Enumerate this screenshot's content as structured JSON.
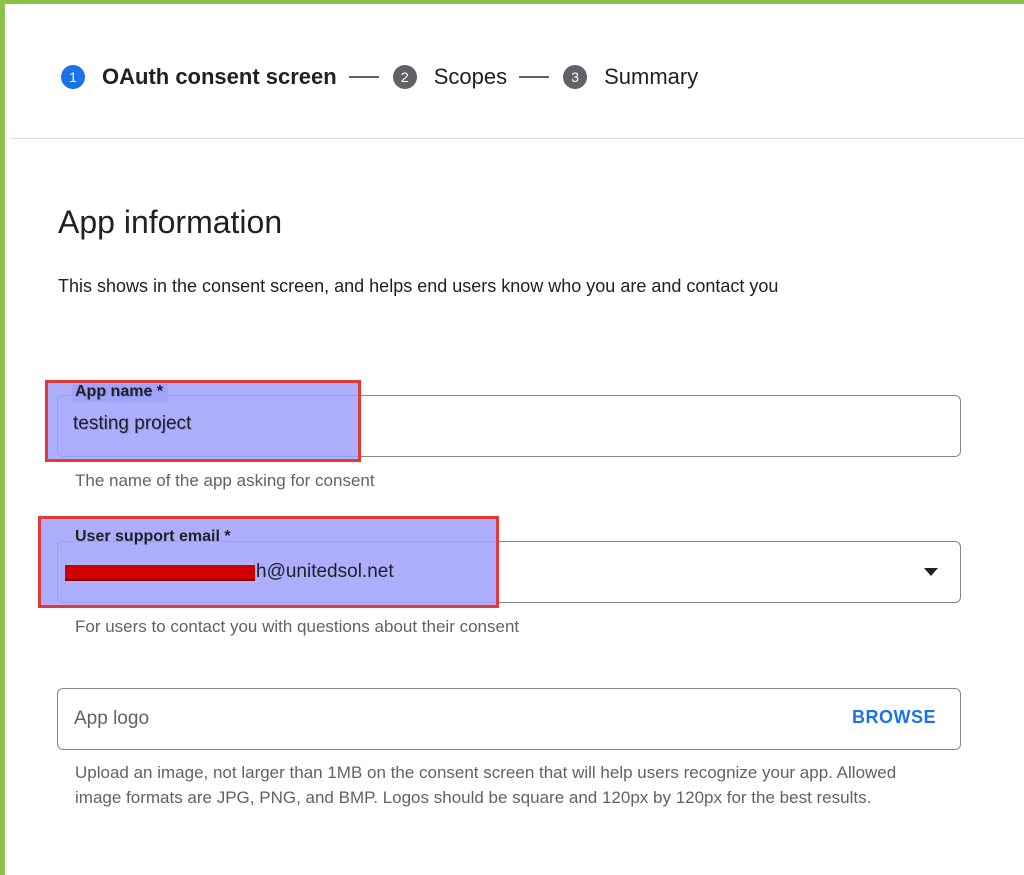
{
  "stepper": {
    "steps": [
      {
        "number": "1",
        "label": "OAuth consent screen",
        "active": true
      },
      {
        "number": "2",
        "label": "Scopes",
        "active": false
      },
      {
        "number": "3",
        "label": "Summary",
        "active": false
      }
    ]
  },
  "section": {
    "title": "App information",
    "description": "This shows in the consent screen, and helps end users know who you are and contact you"
  },
  "app_name": {
    "label": "App name *",
    "value": "testing project",
    "helper": "The name of the app asking for consent"
  },
  "support_email": {
    "label": "User support email *",
    "value_visible": "h@unitedsol.net",
    "helper": "For users to contact you with questions about their consent"
  },
  "app_logo": {
    "placeholder": "App logo",
    "browse_label": "BROWSE",
    "helper": "Upload an image, not larger than 1MB on the consent screen that will help users recognize your app. Allowed image formats are JPG, PNG, and BMP. Logos should be square and 120px by 120px for the best results."
  },
  "colors": {
    "accent": "#1a73e8",
    "frame_border": "#8bc34a",
    "highlight_fill": "#b3b3ff",
    "highlight_border": "#e53935",
    "redaction": "#d00000"
  }
}
